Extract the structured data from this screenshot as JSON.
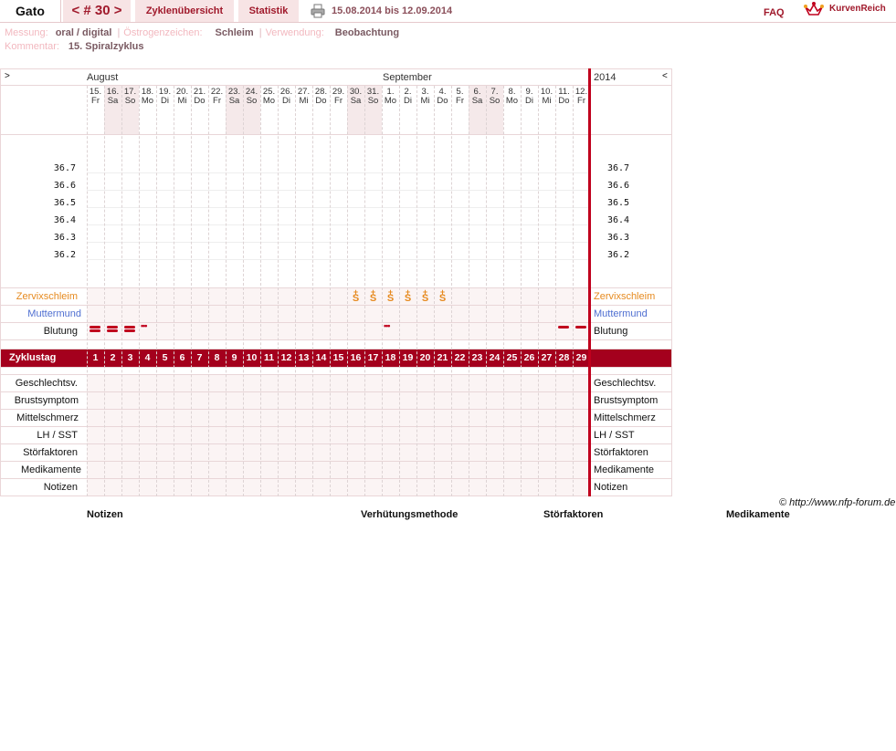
{
  "header": {
    "user": "Gato",
    "cycle_nav": "< # 30 >",
    "tab_overview": "Zyklenübersicht",
    "tab_stats": "Statistik",
    "date_range": "15.08.2014 bis 12.09.2014",
    "faq": "FAQ",
    "logo_text": "KurvenReich"
  },
  "meta": {
    "measure_key": "Messung:",
    "measure_val": "oral / digital",
    "estrogen_key": "Östrogenzeichen:",
    "estrogen_val": "Schleim",
    "usage_key": "Verwendung:",
    "usage_val": "Beobachtung",
    "comment_key": "Kommentar:",
    "comment_val": "15. Spiralzyklus"
  },
  "chart": {
    "nav_left": ">",
    "nav_right": "<",
    "month1": "August",
    "month2": "September",
    "year": "2014",
    "days": [
      {
        "d": "15.",
        "w": "Fr",
        "we": false
      },
      {
        "d": "16.",
        "w": "Sa",
        "we": true
      },
      {
        "d": "17.",
        "w": "So",
        "we": true
      },
      {
        "d": "18.",
        "w": "Mo",
        "we": false
      },
      {
        "d": "19.",
        "w": "Di",
        "we": false
      },
      {
        "d": "20.",
        "w": "Mi",
        "we": false
      },
      {
        "d": "21.",
        "w": "Do",
        "we": false
      },
      {
        "d": "22.",
        "w": "Fr",
        "we": false
      },
      {
        "d": "23.",
        "w": "Sa",
        "we": true
      },
      {
        "d": "24.",
        "w": "So",
        "we": true
      },
      {
        "d": "25.",
        "w": "Mo",
        "we": false
      },
      {
        "d": "26.",
        "w": "Di",
        "we": false
      },
      {
        "d": "27.",
        "w": "Mi",
        "we": false
      },
      {
        "d": "28.",
        "w": "Do",
        "we": false
      },
      {
        "d": "29.",
        "w": "Fr",
        "we": false
      },
      {
        "d": "30.",
        "w": "Sa",
        "we": true
      },
      {
        "d": "31.",
        "w": "So",
        "we": true
      },
      {
        "d": "1.",
        "w": "Mo",
        "we": false
      },
      {
        "d": "2.",
        "w": "Di",
        "we": false
      },
      {
        "d": "3.",
        "w": "Mi",
        "we": false
      },
      {
        "d": "4.",
        "w": "Do",
        "we": false
      },
      {
        "d": "5.",
        "w": "Fr",
        "we": false
      },
      {
        "d": "6.",
        "w": "Sa",
        "we": true
      },
      {
        "d": "7.",
        "w": "So",
        "we": true
      },
      {
        "d": "8.",
        "w": "Mo",
        "we": false
      },
      {
        "d": "9.",
        "w": "Di",
        "we": false
      },
      {
        "d": "10.",
        "w": "Mi",
        "we": false
      },
      {
        "d": "11.",
        "w": "Do",
        "we": false
      },
      {
        "d": "12.",
        "w": "Fr",
        "we": false
      }
    ],
    "temps": [
      "36.7",
      "36.6",
      "36.5",
      "36.4",
      "36.3",
      "36.2"
    ],
    "row_labels": {
      "mucus": "Zervixschleim",
      "cervix": "Muttermund",
      "bleeding": "Blutung",
      "cycleday": "Zyklustag",
      "sex": "Geschlechtsv.",
      "breast": "Brustsymptom",
      "midpain": "Mittelschmerz",
      "lh": "LH / SST",
      "disturb": "Störfaktoren",
      "meds": "Medikamente",
      "notes": "Notizen"
    },
    "mucus_mark": "S",
    "mucus_days": [
      16,
      17,
      18,
      19,
      20,
      21
    ],
    "bleeding": {
      "heavy": [
        1,
        2,
        3
      ],
      "spotting": [
        4,
        18
      ],
      "light": [
        28,
        29
      ]
    },
    "cycle_days": [
      "1",
      "2",
      "3",
      "4",
      "5",
      "6",
      "7",
      "8",
      "9",
      "10",
      "11",
      "12",
      "13",
      "14",
      "15",
      "16",
      "17",
      "18",
      "19",
      "20",
      "21",
      "22",
      "23",
      "24",
      "25",
      "26",
      "27",
      "28",
      "29"
    ]
  },
  "footer": {
    "copyright": "© http://www.nfp-forum.de",
    "col1": "Notizen",
    "col2": "Verhütungsmethode",
    "col3": "Störfaktoren",
    "col4": "Medikamente"
  },
  "colors": {
    "accent": "#a4001d",
    "mucus": "#e68a1f",
    "cervix": "#4f6fd1"
  }
}
